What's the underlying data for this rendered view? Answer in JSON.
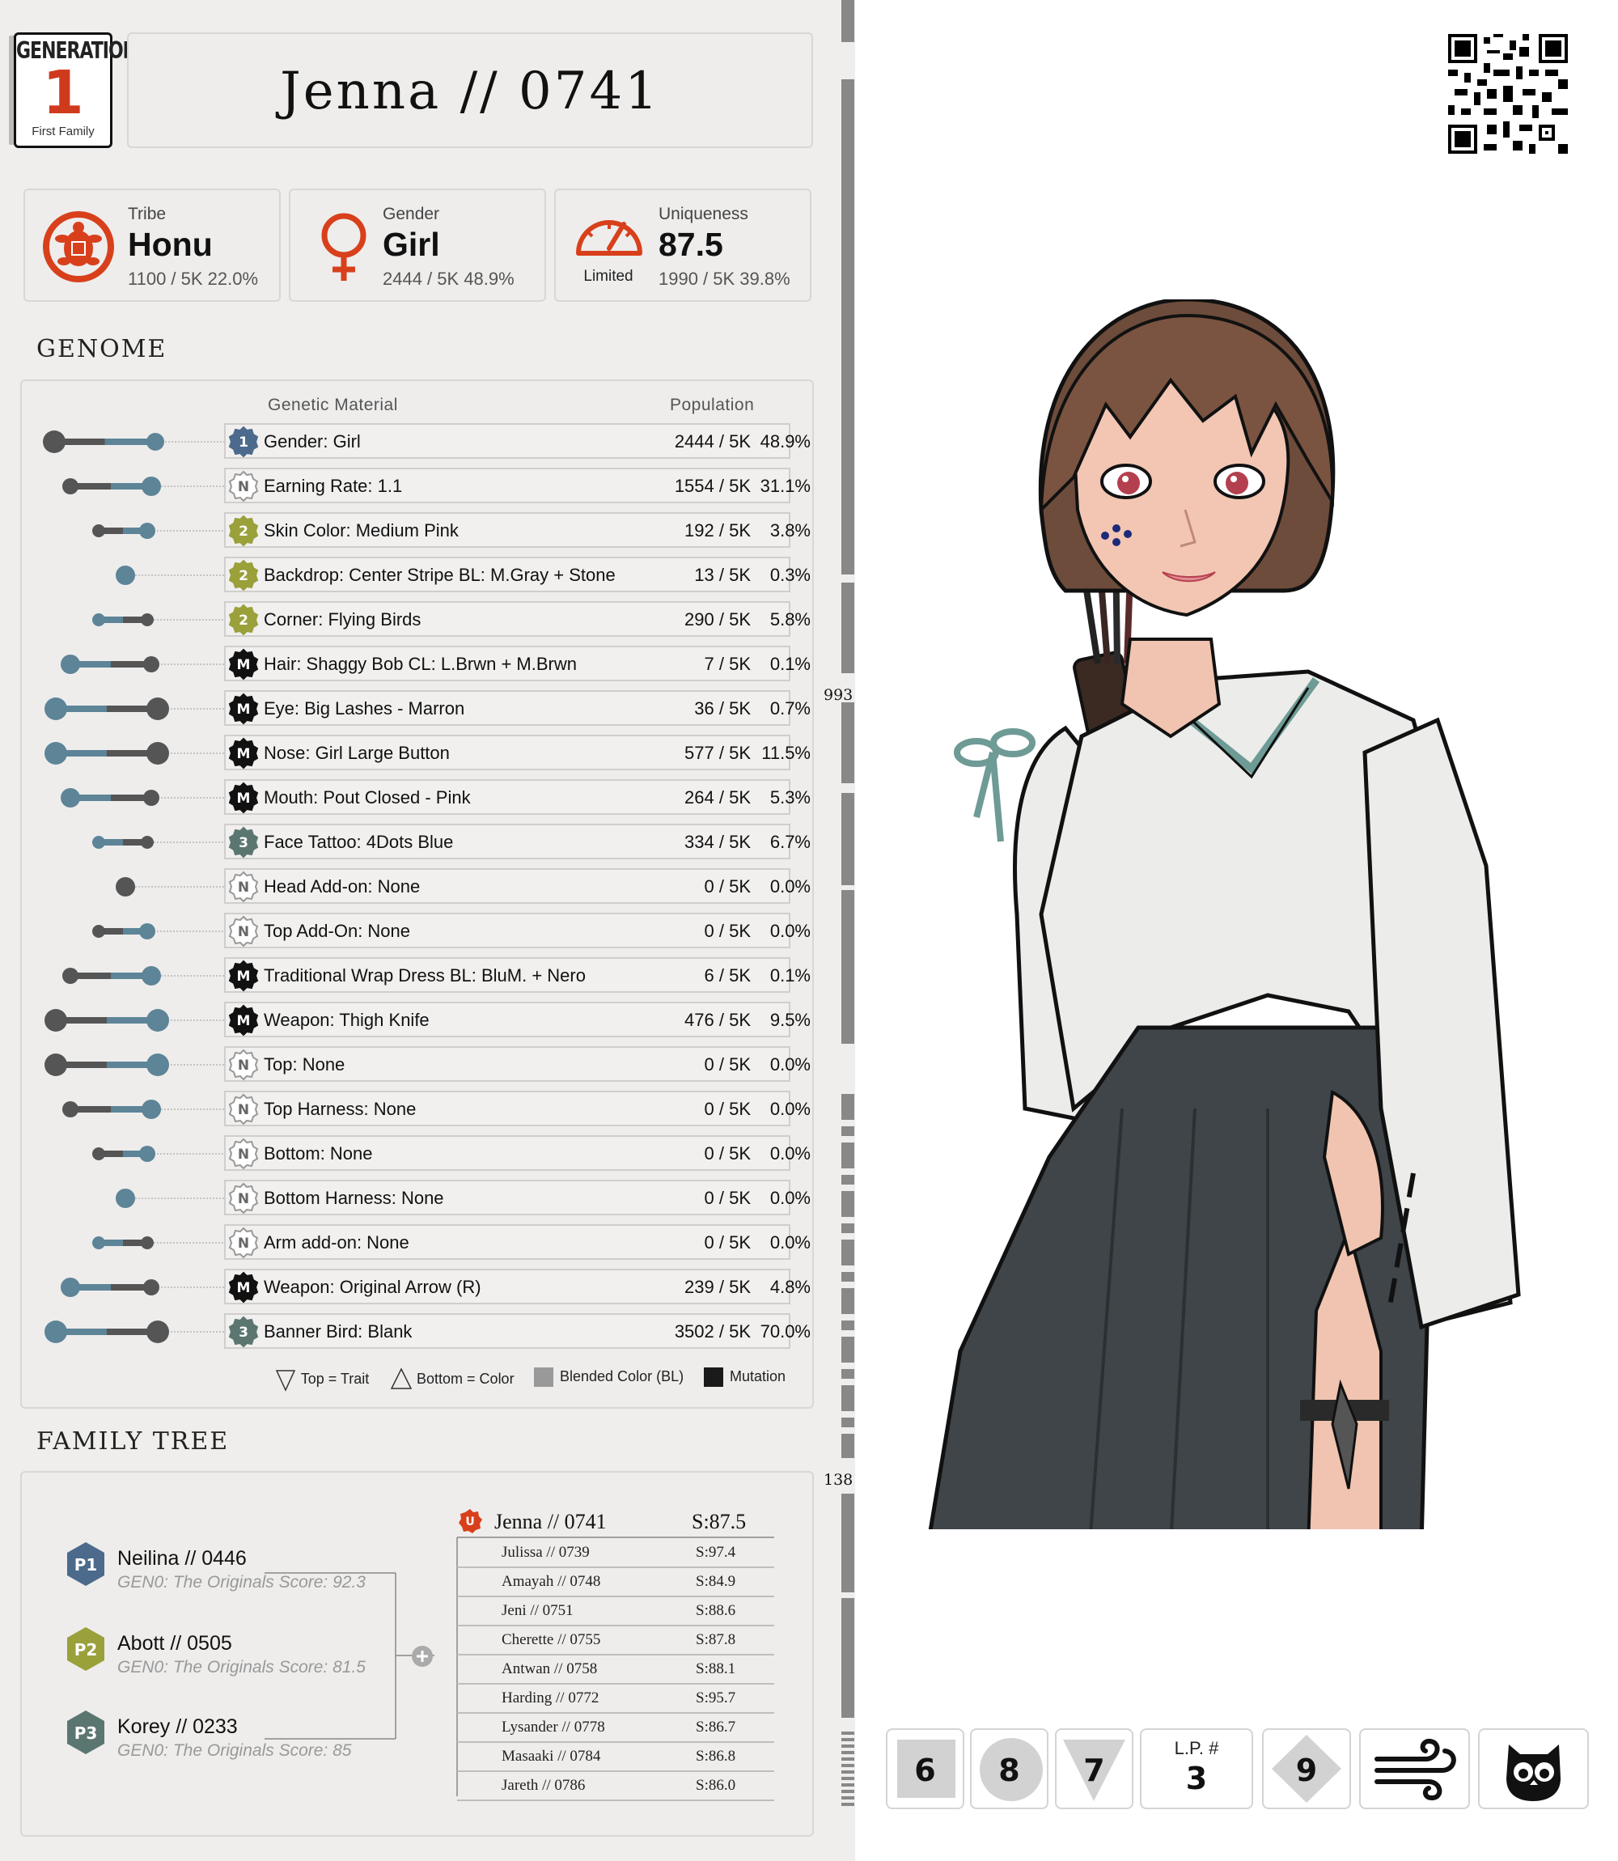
{
  "generation": {
    "label": "GENERATION",
    "number": "1",
    "family": "First Family"
  },
  "title": "Jenna  //  0741",
  "stats": {
    "tribe": {
      "label": "Tribe",
      "value": "Honu",
      "sub": "1100 / 5K  22.0%"
    },
    "gender": {
      "label": "Gender",
      "value": "Girl",
      "sub": "2444 / 5K  48.9%"
    },
    "uniqueness": {
      "label": "Uniqueness",
      "value": "87.5",
      "sub": "1990 / 5K  39.8%",
      "caption": "Limited"
    }
  },
  "genome": {
    "title": "GENOME",
    "header_material": "Genetic Material",
    "header_population": "Population",
    "rows": [
      {
        "badge": "1",
        "name": "Gender: Girl",
        "count": "2444 / 5K",
        "pct": "48.9%"
      },
      {
        "badge": "N",
        "name": "Earning Rate: 1.1",
        "count": "1554 / 5K",
        "pct": "31.1%"
      },
      {
        "badge": "2",
        "name": "Skin Color: Medium Pink",
        "count": "192 / 5K",
        "pct": "3.8%"
      },
      {
        "badge": "2",
        "name": "Backdrop: Center Stripe BL: M.Gray + Stone",
        "count": "13 / 5K",
        "pct": "0.3%"
      },
      {
        "badge": "2",
        "name": "Corner: Flying Birds",
        "count": "290 / 5K",
        "pct": "5.8%"
      },
      {
        "badge": "M",
        "name": "Hair: Shaggy Bob CL: L.Brwn + M.Brwn",
        "count": "7 / 5K",
        "pct": "0.1%"
      },
      {
        "badge": "M",
        "name": "Eye: Big Lashes - Marron",
        "count": "36 / 5K",
        "pct": "0.7%"
      },
      {
        "badge": "M",
        "name": "Nose: Girl Large Button",
        "count": "577 / 5K",
        "pct": "11.5%"
      },
      {
        "badge": "M",
        "name": "Mouth: Pout Closed - Pink",
        "count": "264 / 5K",
        "pct": "5.3%"
      },
      {
        "badge": "3",
        "name": "Face Tattoo: 4Dots Blue",
        "count": "334 / 5K",
        "pct": "6.7%"
      },
      {
        "badge": "N",
        "name": "Head Add-on:  None",
        "count": "0 / 5K",
        "pct": "0.0%"
      },
      {
        "badge": "N",
        "name": "Top Add-On: None",
        "count": "0 / 5K",
        "pct": "0.0%"
      },
      {
        "badge": "M",
        "name": "Traditional Wrap Dress BL: BluM. + Nero",
        "count": "6 / 5K",
        "pct": "0.1%"
      },
      {
        "badge": "M",
        "name": "Weapon: Thigh Knife",
        "count": "476 / 5K",
        "pct": "9.5%"
      },
      {
        "badge": "N",
        "name": "Top: None",
        "count": "0 / 5K",
        "pct": "0.0%"
      },
      {
        "badge": "N",
        "name": "Top Harness: None",
        "count": "0 / 5K",
        "pct": "0.0%"
      },
      {
        "badge": "N",
        "name": "Bottom: None",
        "count": "0 / 5K",
        "pct": "0.0%"
      },
      {
        "badge": "N",
        "name": "Bottom Harness: None",
        "count": "0 / 5K",
        "pct": "0.0%"
      },
      {
        "badge": "N",
        "name": "Arm add-on: None",
        "count": "0 / 5K",
        "pct": "0.0%"
      },
      {
        "badge": "M",
        "name": "Weapon: Original Arrow (R)",
        "count": "239 / 5K",
        "pct": "4.8%"
      },
      {
        "badge": "3",
        "name": "Banner Bird:  Blank",
        "count": "3502 / 5K",
        "pct": "70.0%"
      }
    ],
    "legend": {
      "top": "Top = Trait",
      "bottom": "Bottom = Color",
      "blend": "Blended Color (BL)",
      "mutation": "Mutation"
    }
  },
  "family": {
    "title": "FAMILY TREE",
    "parents": [
      {
        "tag": "P1",
        "name": "Neilina  //  0446",
        "sub": "GEN0: The Originals Score: 92.3",
        "color": "#4b6a8c"
      },
      {
        "tag": "P2",
        "name": "Abott  //  0505",
        "sub": "GEN0: The Originals Score: 81.5",
        "color": "#9aa03a"
      },
      {
        "tag": "P3",
        "name": "Korey  //  0233",
        "sub": "GEN0: The Originals Score: 85",
        "color": "#5b7670"
      }
    ],
    "self": {
      "tag": "U",
      "name": "Jenna // 0741",
      "score": "S:87.5"
    },
    "siblings": [
      {
        "name": "Julissa  //  0739",
        "score": "S:97.4"
      },
      {
        "name": "Amayah  //  0748",
        "score": "S:84.9"
      },
      {
        "name": "Jeni  //  0751",
        "score": "S:88.6"
      },
      {
        "name": "Cherette  //  0755",
        "score": "S:87.8"
      },
      {
        "name": "Antwan  //  0758",
        "score": "S:88.1"
      },
      {
        "name": "Harding  //  0772",
        "score": "S:95.7"
      },
      {
        "name": "Lysander  //  0778",
        "score": "S:86.7"
      },
      {
        "name": "Masaaki  //  0784",
        "score": "S:86.8"
      },
      {
        "name": "Jareth  //  0786",
        "score": "S:86.0"
      }
    ]
  },
  "scroll_marks": [
    "993",
    "138"
  ],
  "bottom_badges": {
    "b1": "6",
    "b2": "8",
    "b3": "7",
    "lp_label": "L.P. #",
    "lp": "3",
    "b5": "9"
  },
  "colors": {
    "accent": "#d8401c",
    "blue_badge": "#4b6a8c",
    "olive_badge": "#9aa03a",
    "teal_badge": "#5b7670",
    "panel": "#efeeed"
  }
}
